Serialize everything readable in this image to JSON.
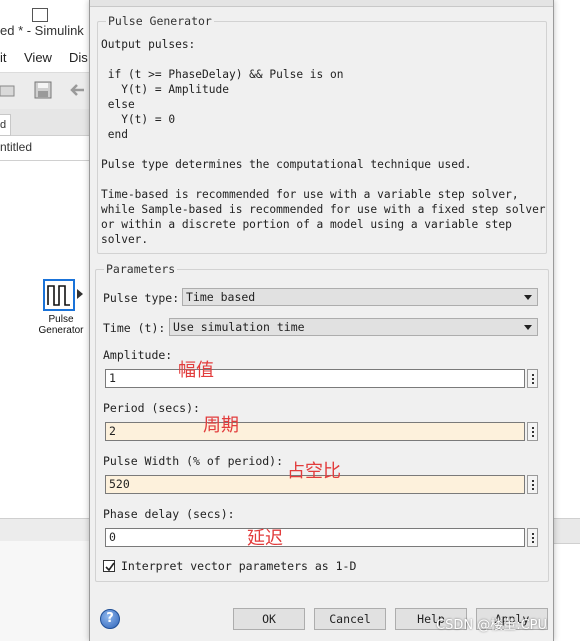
{
  "background_window": {
    "title": "ed * - Simulink",
    "menu": [
      "it",
      "View",
      "Dis"
    ],
    "tab_label": "d",
    "breadcrumb": "ntitled",
    "block_label_line1": "Pulse",
    "block_label_line2": "Generator"
  },
  "dialog": {
    "description": {
      "legend": "Pulse Generator",
      "lines": [
        "Output pulses:",
        "",
        " if (t >= PhaseDelay) && Pulse is on",
        "   Y(t) = Amplitude",
        " else",
        "   Y(t) = 0",
        " end",
        "",
        "Pulse type determines the computational technique used.",
        "",
        "Time-based is recommended for use with a variable step solver,",
        "while Sample-based is recommended for use with a fixed step solver",
        "or within a discrete portion of a model using a variable step",
        "solver."
      ]
    },
    "parameters": {
      "legend": "Parameters",
      "pulse_type_label": "Pulse type:",
      "pulse_type_value": "Time based",
      "time_label": "Time (t):",
      "time_value": "Use simulation time",
      "amplitude_label": "Amplitude:",
      "amplitude_value": "1",
      "period_label": "Period (secs):",
      "period_value": "2",
      "pulse_width_label": "Pulse Width (% of period):",
      "pulse_width_value": "520",
      "phase_delay_label": "Phase delay (secs):",
      "phase_delay_value": "0",
      "interpret_vector_label": "Interpret vector parameters as 1-D",
      "interpret_vector_checked": true
    },
    "annotations": {
      "amplitude": "幅值",
      "period": "周期",
      "pulse_width": "占空比",
      "phase_delay": "延迟"
    },
    "buttons": {
      "ok": "OK",
      "cancel": "Cancel",
      "help": "Help",
      "apply": "Apply"
    },
    "field_highlight_color": "#fdf1dc",
    "annotation_color": "#e23c3c"
  },
  "watermark": "CSDN @楼董:CPU"
}
